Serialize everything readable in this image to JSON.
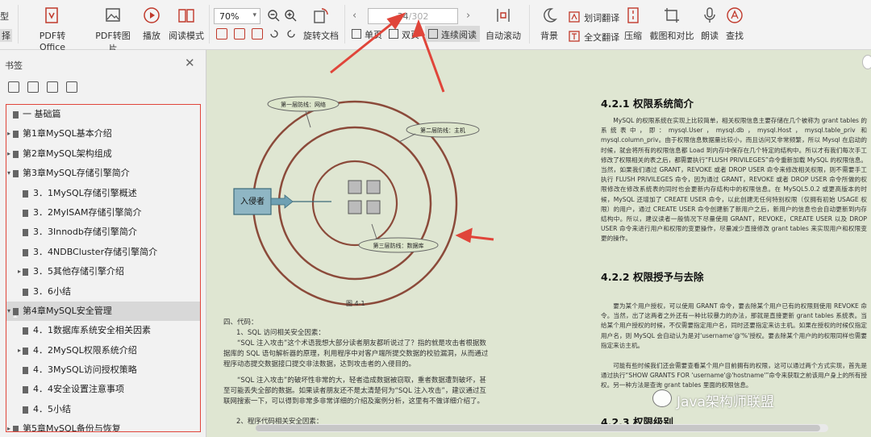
{
  "toolbar": {
    "left_fragments": [
      "型",
      "择"
    ],
    "pdf_to_office": "PDF转Office",
    "pdf_to_image": "PDF转图片",
    "play": "播放",
    "read_mode": "阅读模式",
    "zoom_value": "70%",
    "rotate_doc": "旋转文档",
    "single_page": "单页",
    "double_page": "双页",
    "continuous_read": "连续阅读",
    "page_current": "34",
    "page_total": "/302",
    "auto_scroll": "自动滚动",
    "background": "背景",
    "word_translate": "划词翻译",
    "full_translate": "全文翻译",
    "compress": "压缩",
    "screenshot_compare": "截图和对比",
    "read_aloud": "朗读",
    "find": "查找"
  },
  "sidebar": {
    "title": "书签",
    "items": [
      {
        "label": "一  基础篇",
        "level": 0,
        "arrow": false
      },
      {
        "label": "第1章MySQL基本介绍",
        "level": 0,
        "arrow": true
      },
      {
        "label": "第2章MySQL架构组成",
        "level": 0,
        "arrow": true
      },
      {
        "label": "第3章MySQL存储引擎简介",
        "level": 0,
        "arrow": true,
        "expanded": true
      },
      {
        "label": "3．1MySQL存储引擎概述",
        "level": 1,
        "arrow": false
      },
      {
        "label": "3．2MyISAM存储引擎简介",
        "level": 1,
        "arrow": false
      },
      {
        "label": "3．3Innodb存储引擎简介",
        "level": 1,
        "arrow": false
      },
      {
        "label": "3．4NDBCluster存储引擎简介",
        "level": 1,
        "arrow": false
      },
      {
        "label": "3．5其他存储引擎介绍",
        "level": 1,
        "arrow": true
      },
      {
        "label": "3．6小结",
        "level": 1,
        "arrow": false
      },
      {
        "label": "第4章MySQL安全管理",
        "level": 0,
        "arrow": true,
        "expanded": true,
        "selected": true
      },
      {
        "label": "4．1数据库系统安全相关因素",
        "level": 1,
        "arrow": false
      },
      {
        "label": "4．2MySQL权限系统介绍",
        "level": 1,
        "arrow": true
      },
      {
        "label": "4．3MySQL访问授权策略",
        "level": 1,
        "arrow": false
      },
      {
        "label": "4．4安全设置注意事项",
        "level": 1,
        "arrow": false
      },
      {
        "label": "4．5小结",
        "level": 1,
        "arrow": false
      },
      {
        "label": "第5章MySQL备份与恢复",
        "level": 0,
        "arrow": true
      }
    ]
  },
  "document": {
    "figure": {
      "line1": "第一层防线：网络",
      "line2": "第二层防线：主机",
      "line3": "第三层防线：数据库",
      "intruder": "入侵者",
      "caption": "图 4-1"
    },
    "left_text": {
      "l1": "四、代码：",
      "l2": "1、SQL 访问相关安全因素：",
      "p1": "“SQL 注入攻击”这个术语我想大部分读者朋友都听说过了？指的就是攻击者根据数据库的 SQL 语句解析器的原理，利用程序中对客户端所提交数据的校验漏洞，从而通过程序动态提交数据接口提交非法数据，达到攻击者的入侵目的。",
      "p2": "“SQL 注入攻击”的破坏性非常的大，轻者造成数据被窃取，重者数据遭到破坏，甚至可能丢失全部的数据。如果读者朋友还不是太清楚何为“SQL 注入攻击”，建议通过互联网搜索一下，可以得到非常多非常详细的介绍及案例分析，这里有不做详细介绍了。",
      "l3": "2、程序代码相关安全因素："
    },
    "right_text": {
      "h1": "4.2.1  权限系统简介",
      "p1": "MySQL 的权限系统在实现上比较简单，相关权限信息主要存储在几个被称为 grant tables 的系统表中，即：mysql.User，mysql.db，mysql.Host，mysql.table_priv 和 mysql.column_priv。由于权限信息数据量比较小，而且访问又非常频繁，所以 Mysql 在启动的时候，就会将所有的权限信息都 Load 到内存中保存在几个特定的结构中。所以才有我们每次手工修改了权限相关的表之后，都需要执行“FLUSH PRIVILEGES”命令重新加载 MySQL 的权限信息。当然，如果我们通过 GRANT，REVOKE 或者 DROP USER 命令来修改相关权限，则不需要手工执行 FLUSH PRIVILEGES 命令，因为通过 GRANT，REVOKE 或者 DROP USER 命令所做的权限修改在修改系统表的同时也会更新内存结构中的权限信息。在 MySQL5.0.2 或更高版本的时候，MySQL 还增加了 CREATE USER 命令，以此创建无任何特别权限（仅拥有初始 USAGE 权限）的用户，通过 CREATE USER 命令创建新了新用户之后，新用户的信息也会自动更新到内存结构中。所以，建议读者一般情况下尽量使用 GRANT，REVOKE，CREATE USER 以及 DROP USER 命令来进行用户和权限的变更操作，尽量减少直接修改 grant tables 来实现用户和权限变更的操作。",
      "h2": "4.2.2  权限授予与去除",
      "p2": "要为某个用户授权，可以使用 GRANT 命令，要去除某个用户已有的权限则使用 REVOKE 命令。当然，出了这两者之外还有一种比较暴力的办法，那就是直接更新 grant tables 系统表。当给某个用户授权的时候，不仅需要指定用户名，同时还要指定来访主机。如果在授权的时候仅指定用户名，则 MySQL 会自动认为是对'username'@'%'授权。要去除某个用户的的权限同样也需要指定来访主机。",
      "p3": "可能有些时候我们还会需要查看某个用户目前拥有的权限，这可以通过两个方式实现，首先是通过执行“SHOW GRANTS FOR 'username'@'hostname'”命令来获取之前该用户身上的所有授权。另一种方法是查询 grant tables 里面的权限信息。",
      "h3": "4.2.3  权限级别"
    },
    "watermark": "Java架构师联盟"
  },
  "colors": {
    "highlight_red": "#e0453a",
    "page_bg": "#dfe6d2",
    "ring": "#8b4a3a"
  }
}
